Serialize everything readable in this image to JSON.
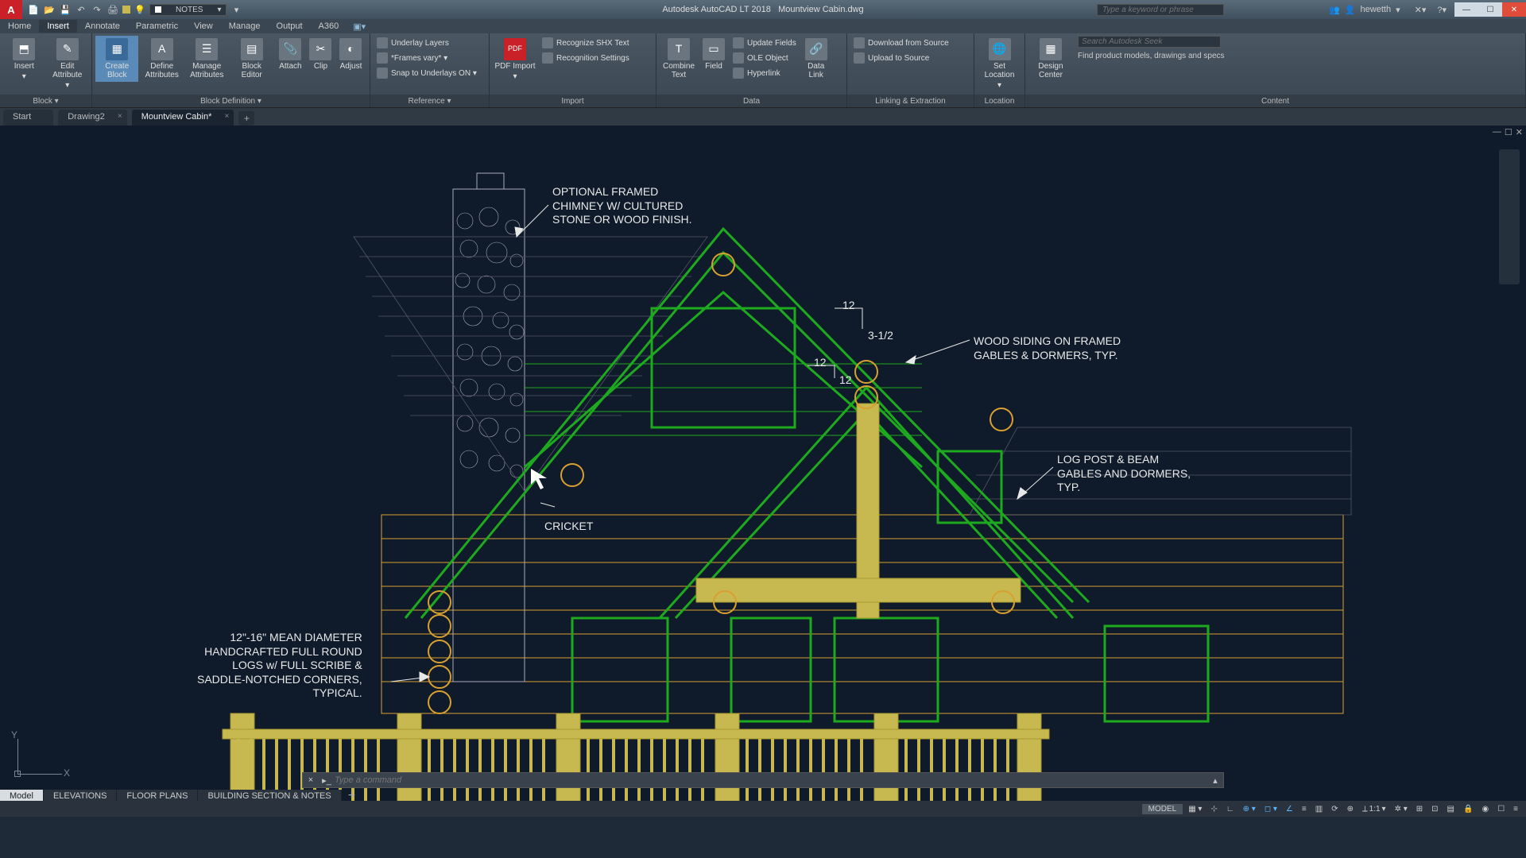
{
  "title": {
    "app": "Autodesk AutoCAD LT 2018",
    "file": "Mountview Cabin.dwg"
  },
  "qat": {
    "layer": "NOTES"
  },
  "search": {
    "placeholder": "Type a keyword or phrase"
  },
  "user": {
    "name": "hewetth"
  },
  "menu": [
    "Home",
    "Insert",
    "Annotate",
    "Parametric",
    "View",
    "Manage",
    "Output",
    "A360"
  ],
  "menu_active": 1,
  "ribbon": {
    "panels": [
      {
        "title": "Block ▾",
        "big": [
          {
            "label": "Insert",
            "icon": "⬒"
          },
          {
            "label": "Edit Attribute",
            "icon": "✎"
          }
        ]
      },
      {
        "title": "Block Definition ▾",
        "big": [
          {
            "label": "Create Block",
            "icon": "▦",
            "hl": true
          },
          {
            "label": "Define Attributes",
            "icon": "A"
          },
          {
            "label": "Manage Attributes",
            "icon": "☰"
          },
          {
            "label": "Block Editor",
            "icon": "▤"
          },
          {
            "label": "Attach",
            "icon": "📎"
          },
          {
            "label": "Clip",
            "icon": "✂"
          },
          {
            "label": "Adjust",
            "icon": "◐"
          }
        ]
      },
      {
        "title": "Reference ▾",
        "rows": [
          "Underlay Layers",
          "*Frames vary* ▾",
          "Snap to Underlays ON ▾"
        ]
      },
      {
        "title": "Import",
        "big": [
          {
            "label": "PDF Import",
            "icon": "PDF"
          }
        ],
        "rows": [
          "Recognize SHX Text",
          "Recognition Settings"
        ]
      },
      {
        "title": "Data",
        "big": [
          {
            "label": "Combine Text",
            "icon": "T"
          },
          {
            "label": "Field",
            "icon": "▭"
          }
        ],
        "rows": [
          "Update Fields",
          "OLE Object",
          "Hyperlink"
        ],
        "big2": [
          {
            "label": "Data Link",
            "icon": "🔗"
          }
        ]
      },
      {
        "title": "Linking & Extraction",
        "rows": [
          "Download from Source",
          "Upload to Source"
        ]
      },
      {
        "title": "Location",
        "big": [
          {
            "label": "Set Location",
            "icon": "🌐"
          }
        ]
      },
      {
        "title": "Content",
        "big": [
          {
            "label": "Design Center",
            "icon": "▦"
          }
        ],
        "extra": {
          "search": "Search Autodesk Seek",
          "hint": "Find product models, drawings and specs"
        }
      }
    ]
  },
  "doctabs": [
    "Start",
    "Drawing2",
    "Mountview Cabin*"
  ],
  "doctab_active": 2,
  "annotations": {
    "chimney": "OPTIONAL FRAMED\nCHIMNEY W/ CULTURED\nSTONE OR WOOD FINISH.",
    "siding": "WOOD SIDING ON FRAMED\nGABLES & DORMERS, TYP.",
    "postbeam": "LOG POST & BEAM\nGABLES AND DORMERS,\nTYP.",
    "cricket": "CRICKET",
    "logs": "12\"-16\" MEAN DIAMETER\nHANDCRAFTED FULL ROUND\nLOGS w/ FULL SCRIBE &\nSADDLE-NOTCHED CORNERS,\nTYPICAL.",
    "pitch_a": "12",
    "pitch_b": "3-1/2",
    "pitch_c": "12",
    "pitch_d": "12"
  },
  "ucs": {
    "y": "Y",
    "x": "X"
  },
  "cmd": {
    "placeholder": "Type a command"
  },
  "layouts": [
    "Model",
    "ELEVATIONS",
    "FLOOR PLANS",
    "BUILDING SECTION & NOTES"
  ],
  "layout_active": 0,
  "status": {
    "model": "MODEL",
    "scale": "1:1"
  }
}
